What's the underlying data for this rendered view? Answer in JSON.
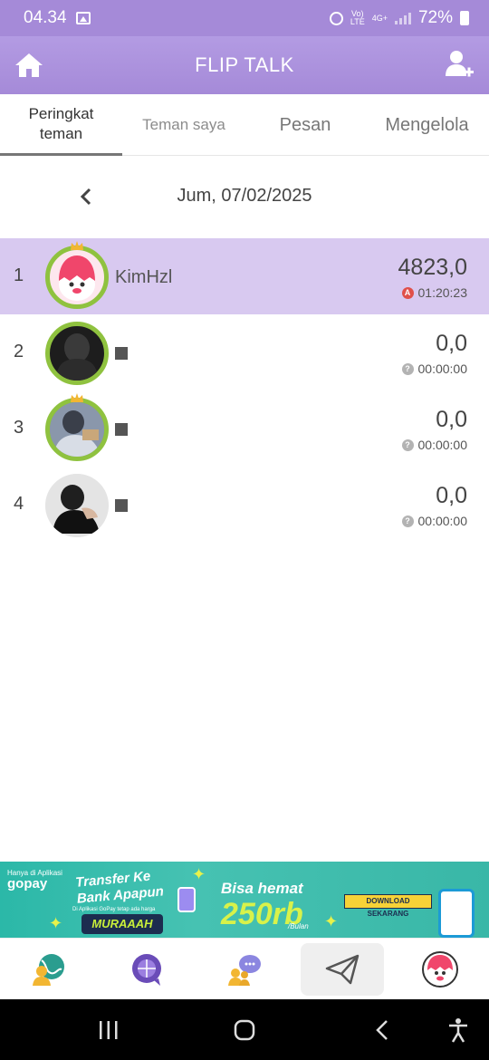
{
  "status_bar": {
    "time": "04.34",
    "network_top": "Vo)",
    "network_bottom": "LTE",
    "data_top": "4G+",
    "battery": "72%",
    "icons": [
      "gallery-icon",
      "alarm-icon",
      "signal-icon",
      "battery-icon"
    ]
  },
  "header": {
    "title": "FLIP TALK",
    "home_icon": "home-icon",
    "add_icon": "add-friend-icon"
  },
  "tabs": [
    {
      "label_line1": "Peringkat",
      "label_line2": "teman",
      "active": true
    },
    {
      "label": "Teman saya",
      "active": false
    },
    {
      "label": "Pesan",
      "active": false
    },
    {
      "label": "Mengelola",
      "active": false
    }
  ],
  "date_nav": {
    "date": "Jum, 07/02/2025",
    "prev_icon": "chevron-left-icon"
  },
  "ranking": [
    {
      "rank": "1",
      "name": "KimHzl",
      "score": "4823,0",
      "time": "01:20:23",
      "time_icon_letter": "A",
      "highlight": true
    },
    {
      "rank": "2",
      "name": "",
      "score": "0,0",
      "time": "00:00:00",
      "time_icon_letter": "?",
      "highlight": false
    },
    {
      "rank": "3",
      "name": "",
      "score": "0,0",
      "time": "00:00:00",
      "time_icon_letter": "?",
      "highlight": false
    },
    {
      "rank": "4",
      "name": "",
      "score": "0,0",
      "time": "00:00:00",
      "time_icon_letter": "?",
      "highlight": false
    }
  ],
  "ad": {
    "small_text": "Hanya di Aplikasi",
    "brand": "gopay",
    "headline": "Transfer Ke Bank Apapun",
    "sub": "Di Aplikasi GoPay tetap ada harga",
    "pill": "MURAAAH",
    "save": "Bisa hemat",
    "amount": "250rb",
    "period": "/Bulan",
    "cta": "DOWNLOAD SEKARANG"
  },
  "bottom_nav": [
    "friends-globe-icon",
    "globe-chat-icon",
    "group-chat-icon",
    "send-icon",
    "profile-avatar-icon"
  ],
  "system_nav": [
    "recent-apps-icon",
    "home-circle-icon",
    "back-icon",
    "accessibility-icon"
  ],
  "colors": {
    "header": "#a58ad8",
    "highlight_row": "#d8c9f0",
    "avatar_ring": "#8fc23f",
    "ad_bg": "#2bb8a8"
  }
}
